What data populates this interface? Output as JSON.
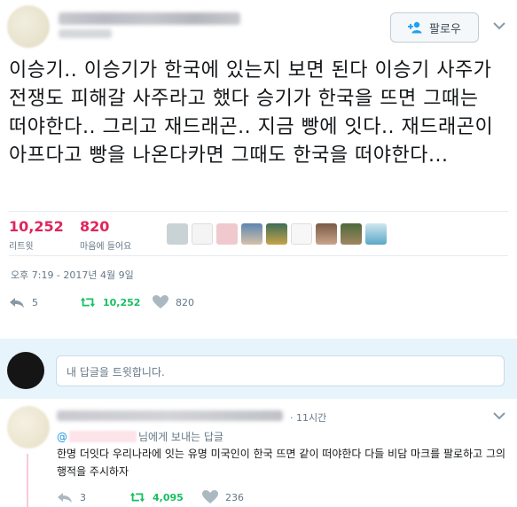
{
  "header": {
    "follow_label": "팔로우"
  },
  "tweet": {
    "text": "이승기.. 이승기가 한국에 있는지 보면 된다 이승기 사주가 전쟁도 피해갈 사주라고 했다 승기가 한국을 뜨면 그때는 떠야한다.. 그리고 재드래곤.. 지금 빵에 잇다.. 재드래곤이 아프다고 빵을 나온다카면 그때도 한국을 떠야한다...",
    "retweets_count": "10,252",
    "retweets_label": "리트윗",
    "likes_count": "820",
    "likes_label": "마음에 들어요",
    "timestamp": "오후 7:19 - 2017년 4월 9일",
    "actions": {
      "reply_count": "5",
      "retweet_count": "10,252",
      "like_count": "820"
    }
  },
  "reply_box": {
    "placeholder": "내 답글을 트윗합니다."
  },
  "reply_tweet": {
    "time": "· 11시간",
    "replying_at": "@",
    "replying_suffix": "님에게 보내는 답글",
    "text": "한명 더잇다 우리나라에 잇는 유명 미국인이 한국 뜨면 같이 떠야한다 다들 비담 마크를 팔로하고 그의 행적을 주시하자",
    "actions": {
      "reply_count": "3",
      "retweet_count": "4,095",
      "like_count": "236"
    }
  },
  "colors": {
    "retweet_green": "#17bf63",
    "like_pink": "#e0245e",
    "link_blue": "#1b95e0",
    "muted_gray": "#657786"
  }
}
